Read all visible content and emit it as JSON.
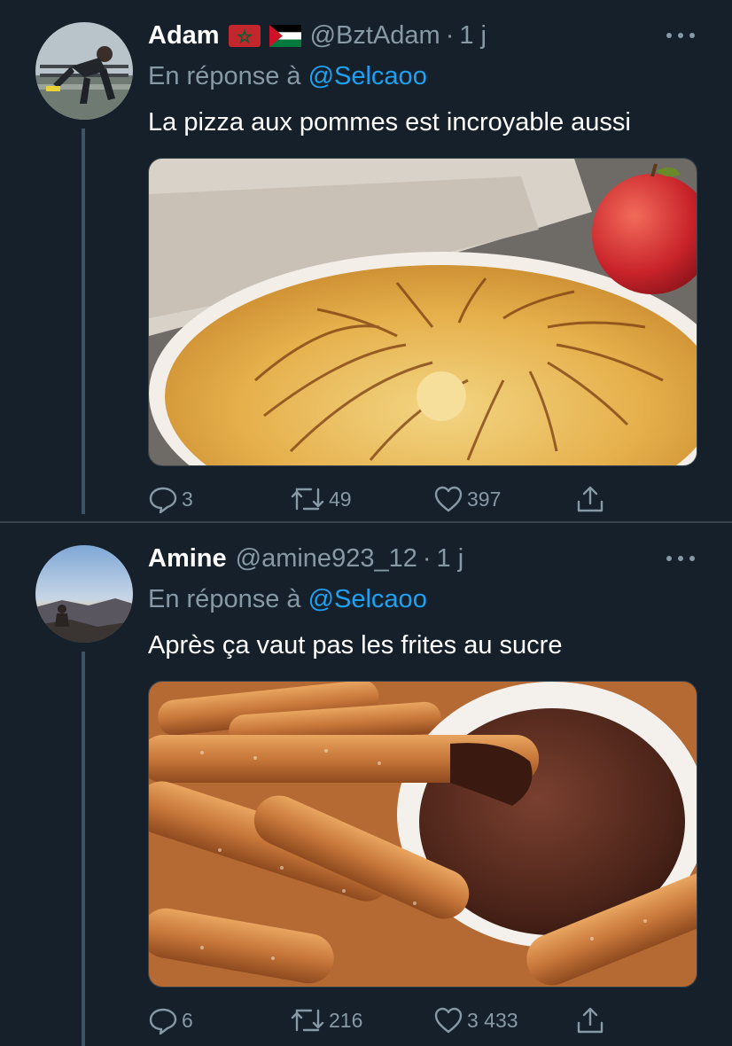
{
  "tweets": [
    {
      "author_name": "Adam",
      "flags": [
        "morocco-flag-icon",
        "palestine-flag-icon"
      ],
      "handle": "@BztAdam",
      "separator": "·",
      "time": "1 j",
      "reply_prefix": "En réponse à",
      "reply_handle": "@Selcaoo",
      "text": "La pizza aux pommes est incroyable aussi",
      "media_subject": "apple-tart-photo",
      "replies": "3",
      "retweets": "49",
      "likes": "397"
    },
    {
      "author_name": "Amine",
      "flags": [],
      "handle": "@amine923_12",
      "separator": "·",
      "time": "1 j",
      "reply_prefix": "En réponse à",
      "reply_handle": "@Selcaoo",
      "text": "Après ça vaut pas les frites au sucre",
      "media_subject": "churros-chocolate-photo",
      "replies": "6",
      "retweets": "216",
      "likes": "3 433"
    }
  ],
  "colors": {
    "background": "#15202b",
    "secondary_text": "#8899a6",
    "link": "#1da1f2",
    "divider": "#38444d",
    "thread_line": "#3d5466"
  }
}
